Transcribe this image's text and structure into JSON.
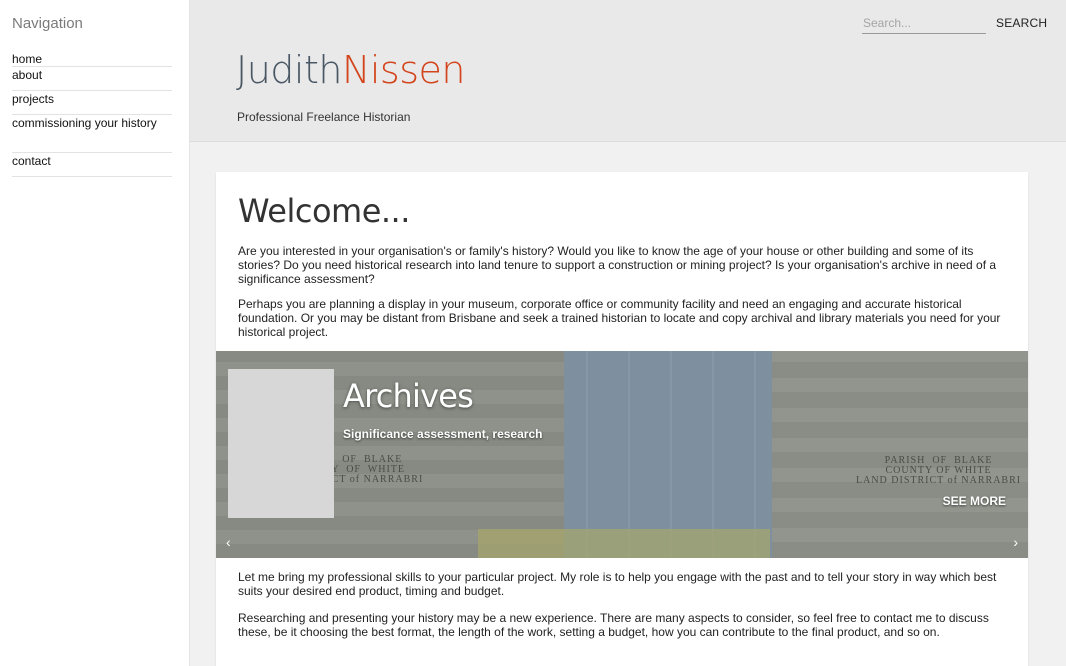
{
  "sidebar": {
    "title": "Navigation",
    "items": [
      {
        "label": "home"
      },
      {
        "label": "about"
      },
      {
        "label": "projects"
      },
      {
        "label": "commissioning your history"
      },
      {
        "label": "contact"
      }
    ]
  },
  "header": {
    "search_placeholder": "Search...",
    "search_button": "SEARCH",
    "logo_first": "Judith",
    "logo_last": "Nissen",
    "tagline": "Professional Freelance Historian"
  },
  "main": {
    "heading": "Welcome...",
    "paragraphs": [
      "Are you interested in your organisation's or family's history? Would you like to know the age of your house or other building and some of its stories? Do you need historical research into land tenure to support a construction or mining project? Is your organisation's archive in need of a significance assessment?",
      "Perhaps you are planning a display in your museum, corporate office or community facility and need an engaging and accurate historical foundation. Or you may be distant from Brisbane and seek a trained historian to locate and copy archival and library materials you need for your historical project.",
      "Let me bring my professional skills to your particular project. My role is to help you engage with the past and to tell your story in way which best suits your desired end product, timing and budget.",
      "Researching and presenting your history may be a new experience. There are many aspects to consider, so feel free to contact me to discuss these, be it choosing the best format, the length of the work, setting a budget, how you can contribute to the final product, and so on."
    ],
    "slider": {
      "title": "Archives",
      "subtitle": "Significance assessment, research",
      "see_more": "SEE MORE",
      "prev_arrow": "‹",
      "next_arrow": "›",
      "stamp_left": "H  OF  BLAKE\nTY  OF  WHITE\nSTRICT of NARRABRI",
      "stamp_right": "PARISH  OF  BLAKE\nCOUNTY OF WHITE\nLAND DISTRICT of NARRABRI"
    }
  },
  "colors": {
    "logo_first": "#4a5866",
    "logo_last": "#d3451c",
    "header_bg": "#e9e9e9"
  }
}
